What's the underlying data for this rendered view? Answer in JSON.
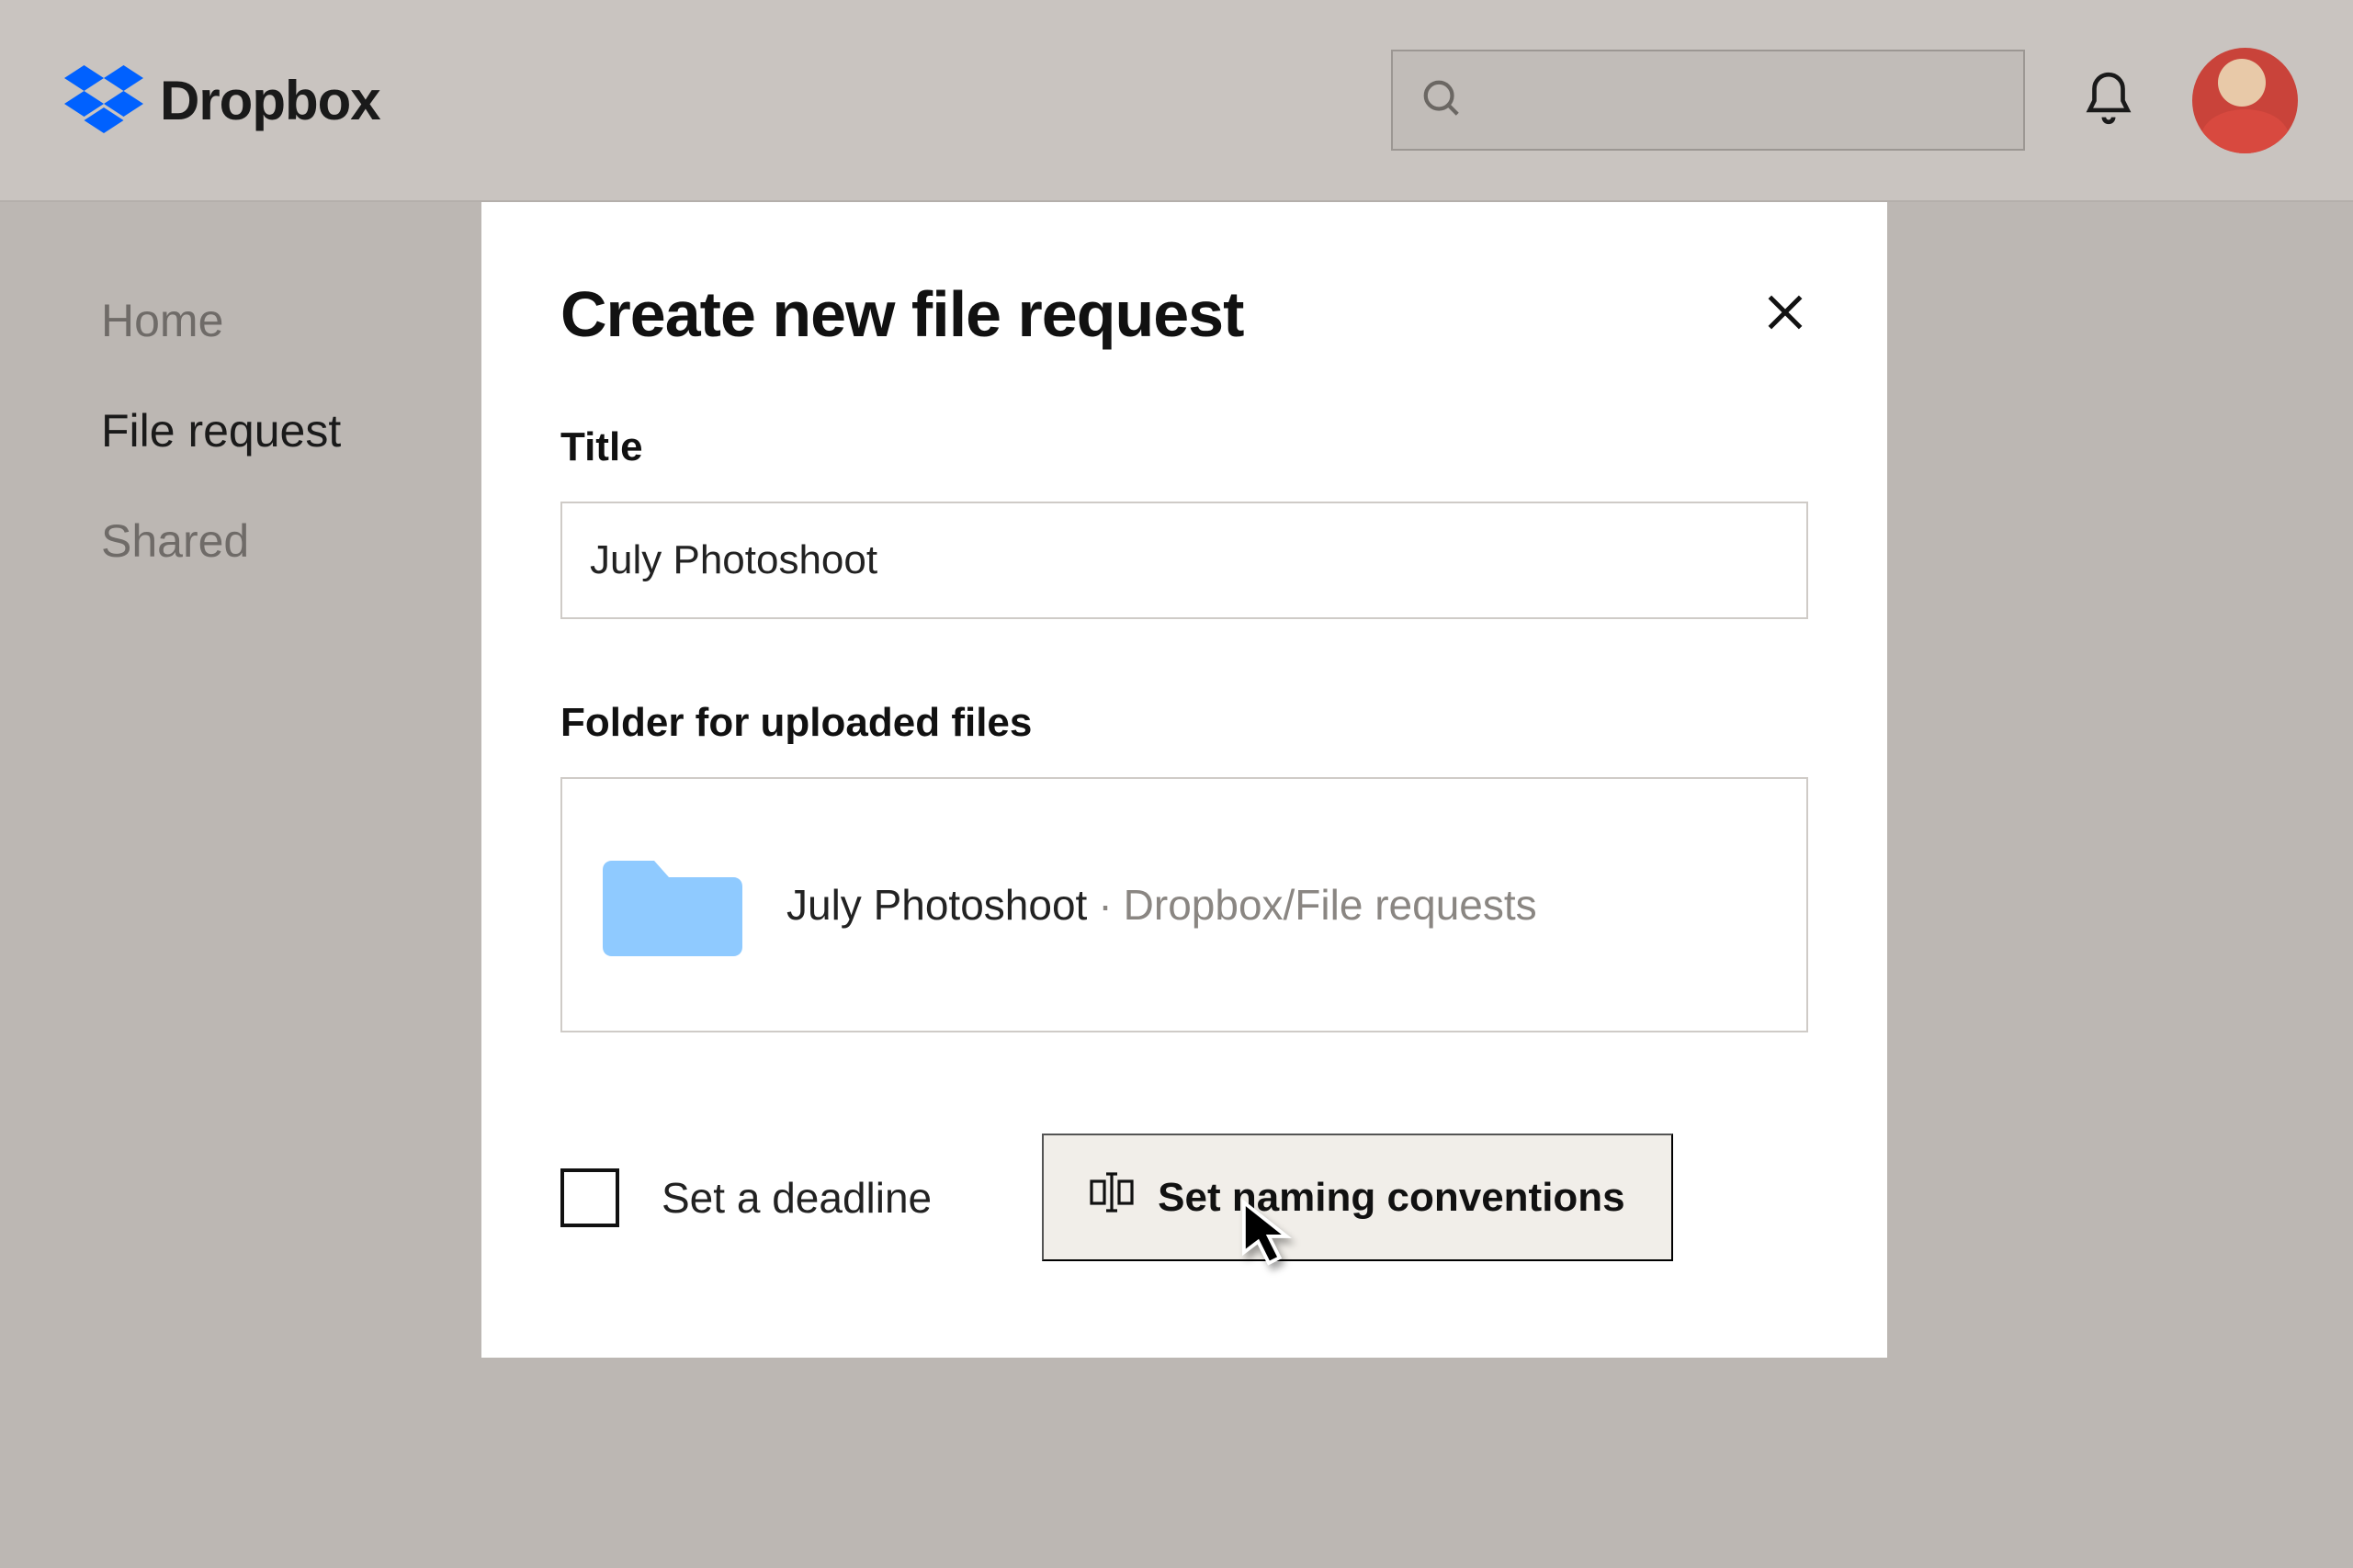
{
  "header": {
    "brand": "Dropbox",
    "search_placeholder": ""
  },
  "sidebar": {
    "items": [
      {
        "label": "Home"
      },
      {
        "label": "File request"
      },
      {
        "label": "Shared"
      }
    ],
    "active_index": 1
  },
  "modal": {
    "title": "Create new file request",
    "title_field": {
      "label": "Title",
      "value": "July Photoshoot"
    },
    "folder_field": {
      "label": "Folder for uploaded files",
      "folder_name": "July Photoshoot",
      "path": "Dropbox/File requests"
    },
    "deadline_checkbox": {
      "label": "Set a deadline",
      "checked": false
    },
    "naming_button": {
      "label": "Set naming conventions"
    }
  }
}
